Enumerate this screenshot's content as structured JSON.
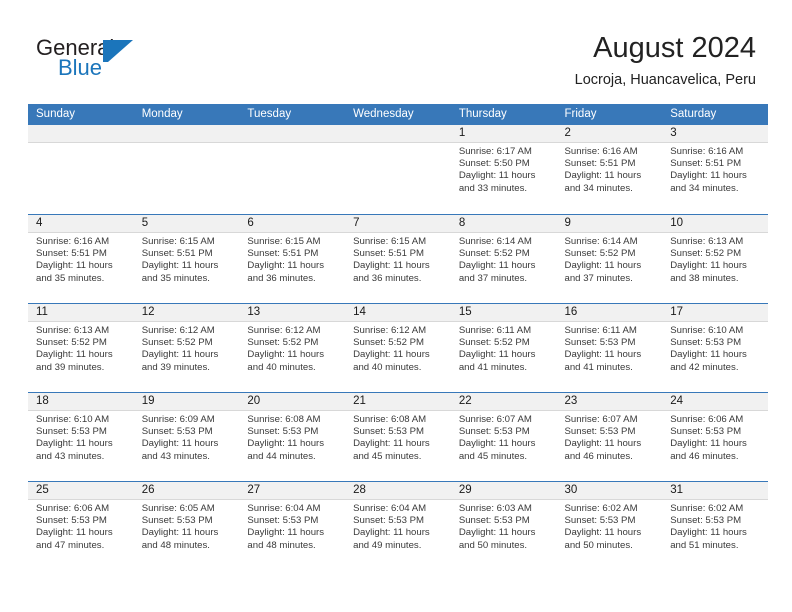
{
  "brand": {
    "word_one": "General",
    "word_two": "Blue",
    "logo_icon": "blue-triangle-flag-icon",
    "accent_color": "#1b75bb"
  },
  "header": {
    "month_title": "August 2024",
    "location": "Locroja, Huancavelica, Peru"
  },
  "calendar": {
    "header_color": "#3878b9",
    "weekdays": [
      "Sunday",
      "Monday",
      "Tuesday",
      "Wednesday",
      "Thursday",
      "Friday",
      "Saturday"
    ],
    "weeks": [
      [
        {
          "day": "",
          "sunrise": "",
          "sunset": "",
          "daylight_line1": "",
          "daylight_line2": ""
        },
        {
          "day": "",
          "sunrise": "",
          "sunset": "",
          "daylight_line1": "",
          "daylight_line2": ""
        },
        {
          "day": "",
          "sunrise": "",
          "sunset": "",
          "daylight_line1": "",
          "daylight_line2": ""
        },
        {
          "day": "",
          "sunrise": "",
          "sunset": "",
          "daylight_line1": "",
          "daylight_line2": ""
        },
        {
          "day": "1",
          "sunrise": "Sunrise: 6:17 AM",
          "sunset": "Sunset: 5:50 PM",
          "daylight_line1": "Daylight: 11 hours",
          "daylight_line2": "and 33 minutes."
        },
        {
          "day": "2",
          "sunrise": "Sunrise: 6:16 AM",
          "sunset": "Sunset: 5:51 PM",
          "daylight_line1": "Daylight: 11 hours",
          "daylight_line2": "and 34 minutes."
        },
        {
          "day": "3",
          "sunrise": "Sunrise: 6:16 AM",
          "sunset": "Sunset: 5:51 PM",
          "daylight_line1": "Daylight: 11 hours",
          "daylight_line2": "and 34 minutes."
        }
      ],
      [
        {
          "day": "4",
          "sunrise": "Sunrise: 6:16 AM",
          "sunset": "Sunset: 5:51 PM",
          "daylight_line1": "Daylight: 11 hours",
          "daylight_line2": "and 35 minutes."
        },
        {
          "day": "5",
          "sunrise": "Sunrise: 6:15 AM",
          "sunset": "Sunset: 5:51 PM",
          "daylight_line1": "Daylight: 11 hours",
          "daylight_line2": "and 35 minutes."
        },
        {
          "day": "6",
          "sunrise": "Sunrise: 6:15 AM",
          "sunset": "Sunset: 5:51 PM",
          "daylight_line1": "Daylight: 11 hours",
          "daylight_line2": "and 36 minutes."
        },
        {
          "day": "7",
          "sunrise": "Sunrise: 6:15 AM",
          "sunset": "Sunset: 5:51 PM",
          "daylight_line1": "Daylight: 11 hours",
          "daylight_line2": "and 36 minutes."
        },
        {
          "day": "8",
          "sunrise": "Sunrise: 6:14 AM",
          "sunset": "Sunset: 5:52 PM",
          "daylight_line1": "Daylight: 11 hours",
          "daylight_line2": "and 37 minutes."
        },
        {
          "day": "9",
          "sunrise": "Sunrise: 6:14 AM",
          "sunset": "Sunset: 5:52 PM",
          "daylight_line1": "Daylight: 11 hours",
          "daylight_line2": "and 37 minutes."
        },
        {
          "day": "10",
          "sunrise": "Sunrise: 6:13 AM",
          "sunset": "Sunset: 5:52 PM",
          "daylight_line1": "Daylight: 11 hours",
          "daylight_line2": "and 38 minutes."
        }
      ],
      [
        {
          "day": "11",
          "sunrise": "Sunrise: 6:13 AM",
          "sunset": "Sunset: 5:52 PM",
          "daylight_line1": "Daylight: 11 hours",
          "daylight_line2": "and 39 minutes."
        },
        {
          "day": "12",
          "sunrise": "Sunrise: 6:12 AM",
          "sunset": "Sunset: 5:52 PM",
          "daylight_line1": "Daylight: 11 hours",
          "daylight_line2": "and 39 minutes."
        },
        {
          "day": "13",
          "sunrise": "Sunrise: 6:12 AM",
          "sunset": "Sunset: 5:52 PM",
          "daylight_line1": "Daylight: 11 hours",
          "daylight_line2": "and 40 minutes."
        },
        {
          "day": "14",
          "sunrise": "Sunrise: 6:12 AM",
          "sunset": "Sunset: 5:52 PM",
          "daylight_line1": "Daylight: 11 hours",
          "daylight_line2": "and 40 minutes."
        },
        {
          "day": "15",
          "sunrise": "Sunrise: 6:11 AM",
          "sunset": "Sunset: 5:52 PM",
          "daylight_line1": "Daylight: 11 hours",
          "daylight_line2": "and 41 minutes."
        },
        {
          "day": "16",
          "sunrise": "Sunrise: 6:11 AM",
          "sunset": "Sunset: 5:53 PM",
          "daylight_line1": "Daylight: 11 hours",
          "daylight_line2": "and 41 minutes."
        },
        {
          "day": "17",
          "sunrise": "Sunrise: 6:10 AM",
          "sunset": "Sunset: 5:53 PM",
          "daylight_line1": "Daylight: 11 hours",
          "daylight_line2": "and 42 minutes."
        }
      ],
      [
        {
          "day": "18",
          "sunrise": "Sunrise: 6:10 AM",
          "sunset": "Sunset: 5:53 PM",
          "daylight_line1": "Daylight: 11 hours",
          "daylight_line2": "and 43 minutes."
        },
        {
          "day": "19",
          "sunrise": "Sunrise: 6:09 AM",
          "sunset": "Sunset: 5:53 PM",
          "daylight_line1": "Daylight: 11 hours",
          "daylight_line2": "and 43 minutes."
        },
        {
          "day": "20",
          "sunrise": "Sunrise: 6:08 AM",
          "sunset": "Sunset: 5:53 PM",
          "daylight_line1": "Daylight: 11 hours",
          "daylight_line2": "and 44 minutes."
        },
        {
          "day": "21",
          "sunrise": "Sunrise: 6:08 AM",
          "sunset": "Sunset: 5:53 PM",
          "daylight_line1": "Daylight: 11 hours",
          "daylight_line2": "and 45 minutes."
        },
        {
          "day": "22",
          "sunrise": "Sunrise: 6:07 AM",
          "sunset": "Sunset: 5:53 PM",
          "daylight_line1": "Daylight: 11 hours",
          "daylight_line2": "and 45 minutes."
        },
        {
          "day": "23",
          "sunrise": "Sunrise: 6:07 AM",
          "sunset": "Sunset: 5:53 PM",
          "daylight_line1": "Daylight: 11 hours",
          "daylight_line2": "and 46 minutes."
        },
        {
          "day": "24",
          "sunrise": "Sunrise: 6:06 AM",
          "sunset": "Sunset: 5:53 PM",
          "daylight_line1": "Daylight: 11 hours",
          "daylight_line2": "and 46 minutes."
        }
      ],
      [
        {
          "day": "25",
          "sunrise": "Sunrise: 6:06 AM",
          "sunset": "Sunset: 5:53 PM",
          "daylight_line1": "Daylight: 11 hours",
          "daylight_line2": "and 47 minutes."
        },
        {
          "day": "26",
          "sunrise": "Sunrise: 6:05 AM",
          "sunset": "Sunset: 5:53 PM",
          "daylight_line1": "Daylight: 11 hours",
          "daylight_line2": "and 48 minutes."
        },
        {
          "day": "27",
          "sunrise": "Sunrise: 6:04 AM",
          "sunset": "Sunset: 5:53 PM",
          "daylight_line1": "Daylight: 11 hours",
          "daylight_line2": "and 48 minutes."
        },
        {
          "day": "28",
          "sunrise": "Sunrise: 6:04 AM",
          "sunset": "Sunset: 5:53 PM",
          "daylight_line1": "Daylight: 11 hours",
          "daylight_line2": "and 49 minutes."
        },
        {
          "day": "29",
          "sunrise": "Sunrise: 6:03 AM",
          "sunset": "Sunset: 5:53 PM",
          "daylight_line1": "Daylight: 11 hours",
          "daylight_line2": "and 50 minutes."
        },
        {
          "day": "30",
          "sunrise": "Sunrise: 6:02 AM",
          "sunset": "Sunset: 5:53 PM",
          "daylight_line1": "Daylight: 11 hours",
          "daylight_line2": "and 50 minutes."
        },
        {
          "day": "31",
          "sunrise": "Sunrise: 6:02 AM",
          "sunset": "Sunset: 5:53 PM",
          "daylight_line1": "Daylight: 11 hours",
          "daylight_line2": "and 51 minutes."
        }
      ]
    ]
  }
}
